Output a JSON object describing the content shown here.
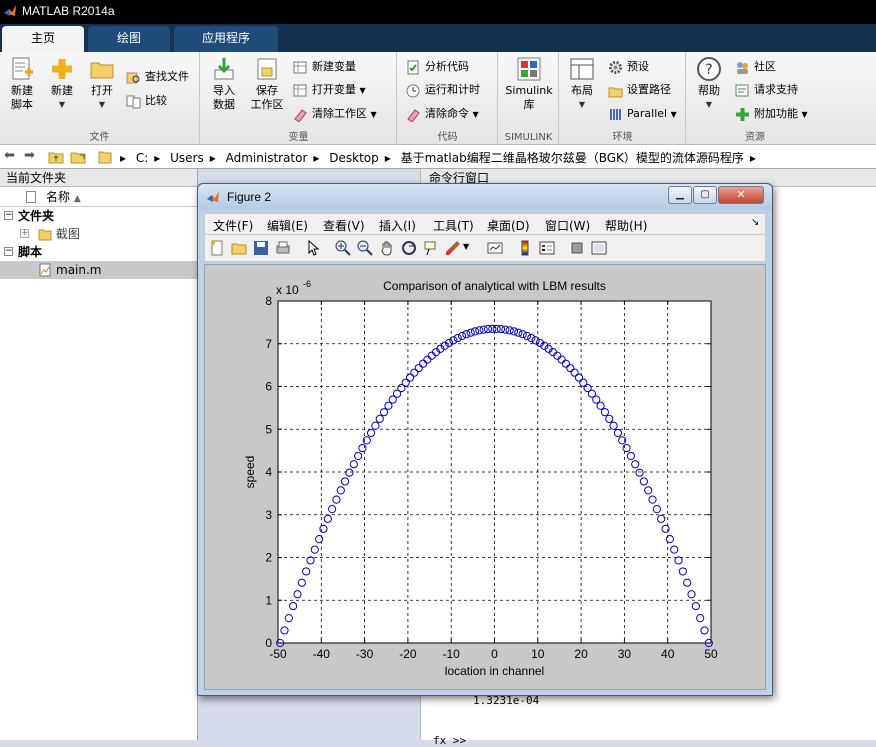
{
  "app": {
    "title": "MATLAB R2014a"
  },
  "tabs": [
    {
      "label": "主页",
      "active": true
    },
    {
      "label": "绘图",
      "active": false
    },
    {
      "label": "应用程序",
      "active": false
    }
  ],
  "ribbon": {
    "file": {
      "label": "文件",
      "new_script": "新建\n脚本",
      "new": "新建",
      "open": "打开",
      "find_files": "查找文件",
      "compare": "比较"
    },
    "variable": {
      "label": "变量",
      "import_data": "导入\n数据",
      "save_workspace": "保存\n工作区",
      "new_variable": "新建变量",
      "open_variable": "打开变量",
      "clear_workspace": "清除工作区"
    },
    "code": {
      "label": "代码",
      "analyze_code": "分析代码",
      "run_and_time": "运行和计时",
      "clear_commands": "清除命令"
    },
    "simulink": {
      "label": "SIMULINK",
      "library": "Simulink\n库"
    },
    "environment": {
      "label": "环境",
      "layout": "布局",
      "preferences": "预设",
      "set_path": "设置路径",
      "parallel": "Parallel"
    },
    "resources": {
      "label": "资源",
      "help": "帮助",
      "community": "社区",
      "request_support": "请求支持",
      "add_ons": "附加功能"
    }
  },
  "address": {
    "crumbs": [
      "C:",
      "Users",
      "Administrator",
      "Desktop",
      "基于matlab编程二维晶格玻尔兹曼（BGK）模型的流体源码程序"
    ]
  },
  "current_folder": {
    "title": "当前文件夹",
    "column_name": "名称",
    "sections": [
      {
        "label": "文件夹",
        "items": [
          {
            "label": "截图",
            "type": "folder"
          }
        ]
      },
      {
        "label": "脚本",
        "items": [
          {
            "label": "main.m",
            "type": "script",
            "selected": true
          }
        ]
      }
    ]
  },
  "command_window": {
    "title": "命令行窗口",
    "output": "1.3231e-04",
    "prompt": "fx >>"
  },
  "figure": {
    "title": "Figure 2",
    "menu": [
      "文件(F)",
      "编辑(E)",
      "查看(V)",
      "插入(I)",
      "工具(T)",
      "桌面(D)",
      "窗口(W)",
      "帮助(H)"
    ],
    "toolbar_icons": [
      "new-figure-icon",
      "open-file-icon",
      "save-icon",
      "print-icon",
      "pointer-icon",
      "zoom-in-icon",
      "zoom-out-icon",
      "pan-icon",
      "rotate-icon",
      "data-cursor-icon",
      "brush-icon",
      "link-plot-icon",
      "colorbar-icon",
      "legend-icon",
      "hide-plot-tools-icon",
      "show-plot-tools-icon"
    ]
  },
  "chart_data": {
    "type": "scatter",
    "title": "Comparison of analytical with LBM results",
    "xlabel": "location in channel",
    "ylabel": "speed",
    "exponent_label": "x 10",
    "exponent": "-6",
    "xlim": [
      -50,
      50
    ],
    "ylim": [
      0,
      8
    ],
    "xticks": [
      -50,
      -40,
      -30,
      -20,
      -10,
      0,
      10,
      20,
      30,
      40,
      50
    ],
    "yticks": [
      0,
      1,
      2,
      3,
      4,
      5,
      6,
      7,
      8
    ],
    "grid": true,
    "marker": "circle",
    "series_color": "#0000cc",
    "series": [
      {
        "formula": "y = 7.35 * (1 - (x/49.5)^2)",
        "x_start": -49.5,
        "x_end": 49.5,
        "x_step": 1,
        "peak": 7.35
      }
    ]
  }
}
